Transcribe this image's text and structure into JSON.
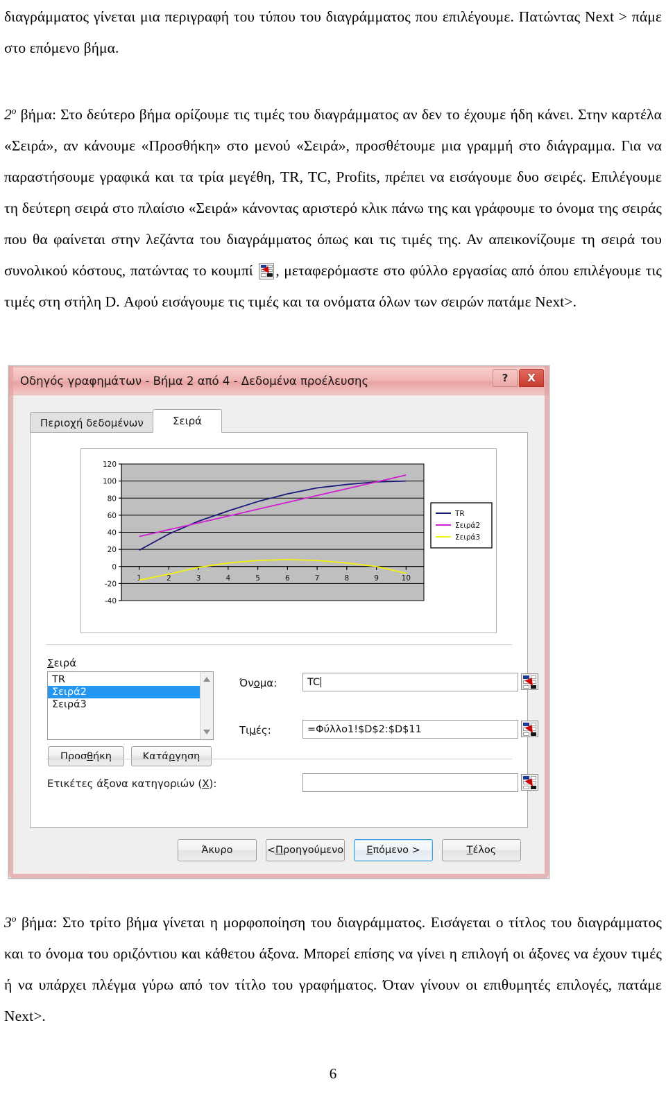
{
  "document": {
    "paragraphs": [
      "διαγράμματος γίνεται μια περιγραφή του τύπου του διαγράμματος που επιλέγουμε. Πατώντας Next > πάμε στο επόμενο βήμα.",
      "βήμα: Στο δεύτερο βήμα ορίζουμε τις τιμές του διαγράμματος αν δεν το έχουμε ήδη κάνει. Στην καρτέλα «Σειρά», αν κάνουμε «Προσθήκη» στο μενού «Σειρά», προσθέτουμε μια γραμμή στο διάγραμμα. Για να παραστήσουμε γραφικά και τα τρία μεγέθη, TR, TC, Profits, πρέπει να εισάγουμε δυο σειρές. Επιλέγουμε τη δεύτερη σειρά στο πλαίσιο «Σειρά» κάνοντας αριστερό κλικ πάνω της και γράφουμε το όνομα της σειράς που θα φαίνεται στην λεζάντα του διαγράμματος όπως και τις τιμές της. Αν απεικονίζουμε τη σειρά του συνολικού κόστους, πατώντας το κουμπί ",
      ", μεταφερόμαστε στο φύλλο εργασίας από όπου επιλέγουμε τις τιμές στη στήλη D. Αφού εισάγουμε τις τιμές και τα ονόματα όλων των σειρών πατάμε Next>.",
      "βήμα: Στο τρίτο βήμα γίνεται η μορφοποίηση του διαγράμματος. Εισάγεται ο τίτλος του διαγράμματος και το όνομα του οριζόντιου και κάθετου άξονα. Μπορεί επίσης να γίνει η επιλογή οι άξονες να έχουν τιμές ή να υπάρχει πλέγμα γύρω από τον τίτλο του γραφήματος. Όταν γίνουν οι επιθυμητές επιλογές, πατάμε Next>."
    ],
    "step2_marker_number": "2",
    "step2_marker_sup": "ο",
    "step3_marker_number": "3",
    "step3_marker_sup": "ο",
    "page_number": "6"
  },
  "dialog": {
    "title": "Οδηγός γραφημάτων - Βήμα 2 από 4 - Δεδομένα προέλευσης",
    "help_button": "?",
    "close_button": "X",
    "tabs": [
      {
        "label": "Περιοχή δεδομένων",
        "active": false
      },
      {
        "label": "Σειρά",
        "active": true
      }
    ],
    "series_group_label": "Σειρά",
    "series_list": [
      "TR",
      "Σειρά2",
      "Σειρά3"
    ],
    "series_selected": "Σειρά2",
    "add_button": "Προσθήκη",
    "remove_button": "Κατάργηση",
    "name_label": "Όνομα:",
    "name_value": "TC",
    "values_label": "Τιμές:",
    "values_value": "=Φύλλο1!$D$2:$D$11",
    "category_labels_label": "Ετικέτες άξονα κατηγοριών (X):",
    "category_labels_value": "",
    "range_picker_icon": "range-select-icon",
    "footer_buttons": [
      {
        "label": "Άκυρο",
        "default": false
      },
      {
        "label": "< Προηγούμενο",
        "default": false
      },
      {
        "label": "Επόμενο >",
        "default": true
      },
      {
        "label": "Τέλος",
        "default": false
      }
    ]
  },
  "chart_data": {
    "type": "line",
    "title": "",
    "xlabel": "",
    "ylabel": "",
    "x": [
      1,
      2,
      3,
      4,
      5,
      6,
      7,
      8,
      9,
      10
    ],
    "xlim": [
      0.4,
      10.6
    ],
    "ylim": [
      -40,
      120
    ],
    "yticks": [
      -40,
      -20,
      0,
      20,
      40,
      60,
      80,
      100,
      120
    ],
    "xticks": [
      1,
      2,
      3,
      4,
      5,
      6,
      7,
      8,
      9,
      10
    ],
    "grid": true,
    "legend_position": "right",
    "plot_background": "#bfbfbf",
    "series": [
      {
        "name": "TR",
        "color": "#19197a",
        "values": [
          19,
          38,
          53,
          65,
          76,
          85,
          92,
          96,
          99,
          100
        ]
      },
      {
        "name": "Σειρά2",
        "color": "#d11fd1",
        "values": [
          35,
          43,
          51,
          59,
          67,
          75,
          83,
          91,
          99,
          107
        ]
      },
      {
        "name": "Σειρά3",
        "color": "#f2f20a",
        "values": [
          -16,
          -9,
          -1,
          4,
          7,
          8,
          7,
          4,
          0,
          -8
        ]
      }
    ]
  }
}
